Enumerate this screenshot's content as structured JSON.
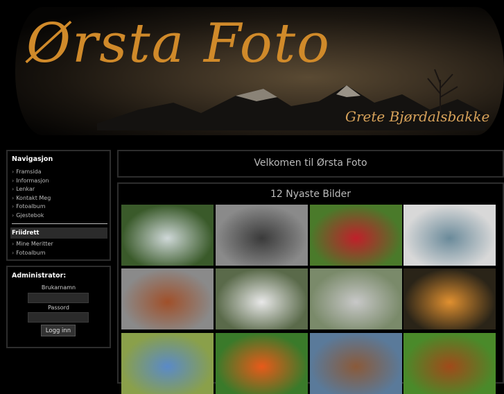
{
  "banner": {
    "title": "Ørsta Foto",
    "subtitle": "Grete Bjørdalsbakke"
  },
  "nav": {
    "title": "Navigasjon",
    "items": [
      "Framsida",
      "Informasjon",
      "Lenkar",
      "Kontakt Meg",
      "Fotoalbum",
      "Gjestebok"
    ],
    "section": "Friidrett",
    "sub_items": [
      "Mine Meritter",
      "Fotoalbum"
    ]
  },
  "admin": {
    "title": "Administrator:",
    "username_label": "Brukarnamn",
    "password_label": "Passord",
    "login_button": "Logg inn"
  },
  "welcome": {
    "title": "Velkomen til Ørsta Foto"
  },
  "gallery": {
    "title": "12 Nyaste Bilder",
    "thumbnails": [
      {
        "subject": "waterfall-forest",
        "colors": [
          "#3a5a2a",
          "#cfd8d8"
        ]
      },
      {
        "subject": "wrecked-car",
        "colors": [
          "#8a8a8a",
          "#3a3a3a"
        ]
      },
      {
        "subject": "red-poppy-bud",
        "colors": [
          "#4a7a2a",
          "#c0202a"
        ]
      },
      {
        "subject": "misty-lake",
        "colors": [
          "#d8d8d8",
          "#6a8a9a"
        ]
      },
      {
        "subject": "red-squirrel",
        "colors": [
          "#8a8a8a",
          "#a0502a"
        ]
      },
      {
        "subject": "river-valley",
        "colors": [
          "#5a6a4a",
          "#e8e8e8"
        ]
      },
      {
        "subject": "sheep-mountains",
        "colors": [
          "#7a8a6a",
          "#c8c8c8"
        ]
      },
      {
        "subject": "sunset-sea",
        "colors": [
          "#2a2418",
          "#e09030"
        ]
      },
      {
        "subject": "mountain-meadow",
        "colors": [
          "#8aa04a",
          "#5a8ac8"
        ]
      },
      {
        "subject": "gerbera-flower",
        "colors": [
          "#3a7a2a",
          "#e85a1a"
        ]
      },
      {
        "subject": "harbor-town",
        "colors": [
          "#5a7a9a",
          "#8a5a3a"
        ]
      },
      {
        "subject": "setter-dog",
        "colors": [
          "#4a8a2a",
          "#a04a1a"
        ]
      }
    ]
  }
}
